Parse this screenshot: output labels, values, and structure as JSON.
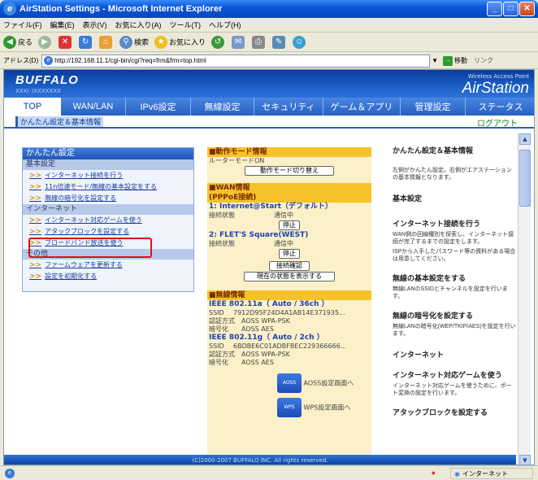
{
  "window": {
    "title": "AirStation Settings - Microsoft Internet Explorer",
    "ie_glyph": "e"
  },
  "window_buttons": [
    "_",
    "□",
    "✕"
  ],
  "menubar": [
    "ファイル(F)",
    "編集(E)",
    "表示(V)",
    "お気に入り(A)",
    "ツール(T)",
    "ヘルプ(H)"
  ],
  "toolbar": {
    "back": "戻る",
    "search": "検索",
    "favorites": "お気に入り"
  },
  "address": {
    "label": "アドレス(D)",
    "url": "http://192.168.11.1/cgi-bin/cgi?req=frm&frm=top.html",
    "go": "移動",
    "links": "リンク"
  },
  "header": {
    "logo": "BUFFALO",
    "slogan": "XXX(-)XXXXXXX",
    "wlap": "Wireless Access Point",
    "brand": "AirStation"
  },
  "nav_tabs": [
    {
      "label": "TOP",
      "active": true
    },
    {
      "label": "WAN/LAN"
    },
    {
      "label": "IPv6設定"
    },
    {
      "label": "無線設定"
    },
    {
      "label": "セキュリティ"
    },
    {
      "label": "ゲーム＆アプリ"
    },
    {
      "label": "管理設定"
    },
    {
      "label": "ステータス"
    }
  ],
  "subbar": {
    "breadcrumb": "かんたん設定＆基本情報",
    "logout": "ログアウト"
  },
  "left_menu": {
    "title": "かんたん設定",
    "sections": [
      {
        "label": "基本設定",
        "items": [
          "インターネット接続を行う",
          "11n倍速モード/無線の基本設定をする",
          "無線の暗号化を設定する"
        ]
      },
      {
        "label": "インターネット",
        "items": [
          "インターネット対応ゲームを使う",
          "アタックブロックを設定する",
          "ブロードバンド放送を使う"
        ]
      },
      {
        "label": "その他",
        "items": [
          "ファームウェアを更新する",
          "設定を初期化する"
        ]
      }
    ]
  },
  "center": {
    "mode": {
      "head": "■動作モード情報",
      "line": "ルーターモードON",
      "button": "動作モード切り替え"
    },
    "wan": {
      "head": "■WAN情報",
      "sub": "(PPPoE接続)",
      "c1": {
        "name": "1: Internet@Start（デフォルト）",
        "status_label": "接続状態",
        "status": "通信中",
        "button": "停止"
      },
      "c2": {
        "name": "2: FLET'S Square(WEST)",
        "status_label": "接続状態",
        "status": "通信中",
        "button": "停止"
      },
      "check_button": "接続確認",
      "status_button": "現在の状態を表示する"
    },
    "wireless": {
      "head": "■無線情報",
      "a": {
        "band": "IEEE 802.11a（ Auto / 36ch ）",
        "ssid_label": "SSID",
        "ssid": "7912D95F24D4A1AB14E371935...",
        "auth_label": "認証方式",
        "auth": "AOSS WPA-PSK",
        "enc_label": "暗号化",
        "enc": "AOSS AES"
      },
      "g": {
        "band": "IEEE 802.11g（ Auto / 2ch ）",
        "ssid_label": "SSID",
        "ssid": "6BDBE6C01ADBFBEC229366666...",
        "auth_label": "認証方式",
        "auth": "AOSS WPA-PSK",
        "enc_label": "暗号化",
        "enc": "AOSS AES"
      },
      "aoss_badge": "AOSS",
      "aoss_link": "AOSS設定画面へ",
      "wps_badge": "WPS",
      "wps_link": "WPS設定画面へ"
    }
  },
  "right": {
    "title": "かんたん設定＆基本情報",
    "intro": "左側がかんたん設定。右側がエアステーションの基本情報となります。",
    "s1": "基本設定",
    "h1": "インターネット接続を行う",
    "t1a": "WAN側の回線種別を探索し、インターネット接続が完了するまでの設定をします。",
    "t1b": "ISPから入手したパスワード等の資料がある場合は用意してください。",
    "h2": "無線の基本設定をする",
    "t2": "無線LANのSSIDとチャンネルを設定を行います。",
    "h3": "無線の暗号化を設定する",
    "t3": "無線LANの暗号化(WEP/TKIP/AES)を設定を行います。",
    "s2": "インターネット",
    "h4": "インターネット対応ゲームを使う",
    "t4": "インターネット対応ゲームを使うために、ポート変換の設定を行います。",
    "h5": "アタックブロックを設定する"
  },
  "scrollbar": {
    "up": "▲",
    "down": "▼"
  },
  "footer": "(C)2000-2007 BUFFALO INC. All rights reserved.",
  "statusbar": {
    "zone": "インターネット"
  }
}
